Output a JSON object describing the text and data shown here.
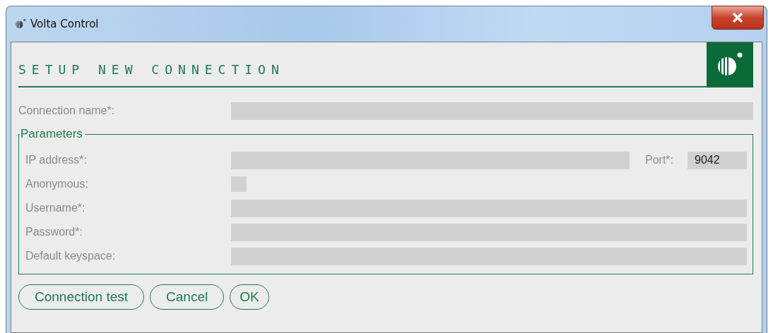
{
  "window": {
    "title": "Volta Control"
  },
  "header": {
    "title": "SETUP NEW CONNECTION"
  },
  "connection_name": {
    "label": "Connection name*:"
  },
  "parameters": {
    "legend": "Parameters",
    "rows": [
      {
        "kind": "text",
        "label": "IP address*:",
        "port": {
          "label": "Port*:",
          "value": "9042"
        }
      },
      {
        "kind": "checkbox",
        "label": "Anonymous:",
        "checked": false
      },
      {
        "kind": "text",
        "label": "Username*:"
      },
      {
        "kind": "text",
        "label": "Password*:"
      },
      {
        "kind": "text",
        "label": "Default keyspace:"
      }
    ]
  },
  "buttons": [
    "Connection test",
    "Cancel",
    "OK"
  ]
}
